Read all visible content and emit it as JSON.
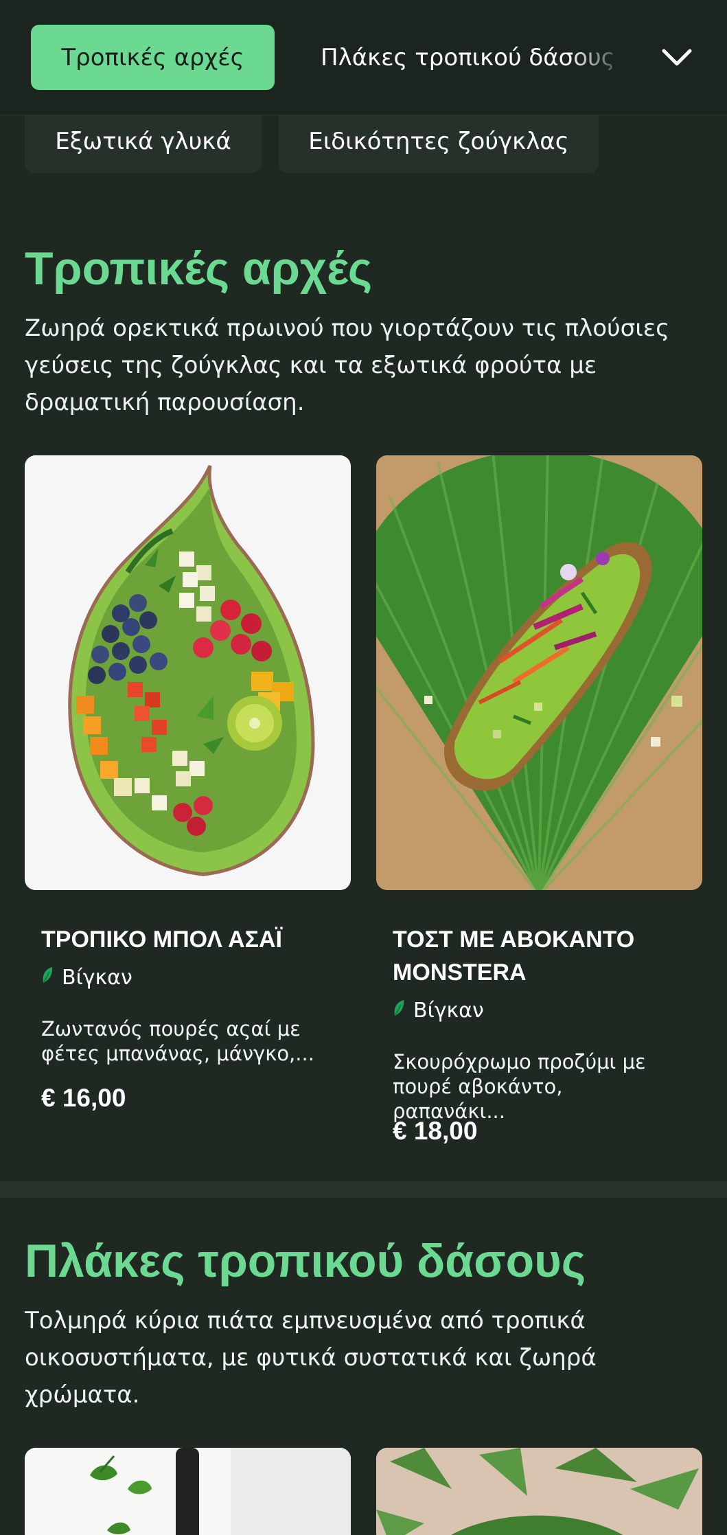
{
  "nav": {
    "tabs": [
      {
        "label": "Τροπικές αρχές",
        "active": true
      },
      {
        "label": "Πλάκες τροπικού δάσους",
        "active": false
      },
      {
        "label": "Εξωτικά γλυκά",
        "active": false
      },
      {
        "label": "Ειδικότητες ζούγκλας",
        "active": false
      }
    ],
    "expand_icon": "chevron-down-icon"
  },
  "sections": [
    {
      "title": "Τροπικές αρχές",
      "description": "Ζωηρά ορεκτικά πρωινού που γιορτάζουν τις πλούσιες γεύσεις της ζούγκλας και τα εξωτικά φρούτα με δραματική παρουσίαση.",
      "items": [
        {
          "name": "ΤΡΟΠΙΚΟ ΜΠΟΛ ΑΣΑΪ",
          "tag": "Βίγκαν",
          "tag_icon": "leaf-icon",
          "description": "Ζωντανός πουρές αςαί με φέτες μπανάνας, μάνγκο,...",
          "price": "€ 16,00"
        },
        {
          "name": "ΤΟΣΤ ΜΕ ΑΒΟΚΑΝΤΟ MONSTERA",
          "tag": "Βίγκαν",
          "tag_icon": "leaf-icon",
          "description": "Σκουρόχρωμο προζύμι με πουρέ αβοκάντο, ραπανάκι...",
          "price": "€ 18,00"
        }
      ]
    },
    {
      "title": "Πλάκες τροπικού δάσους",
      "description": "Τολμηρά κύρια πιάτα εμπνευσμένα από τροπικά οικοσυστήματα, με φυτικά συστατικά και ζωηρά χρώματα."
    }
  ],
  "colors": {
    "background": "#1f2922",
    "accent": "#6bd991",
    "leaf": "#1ea35a"
  }
}
